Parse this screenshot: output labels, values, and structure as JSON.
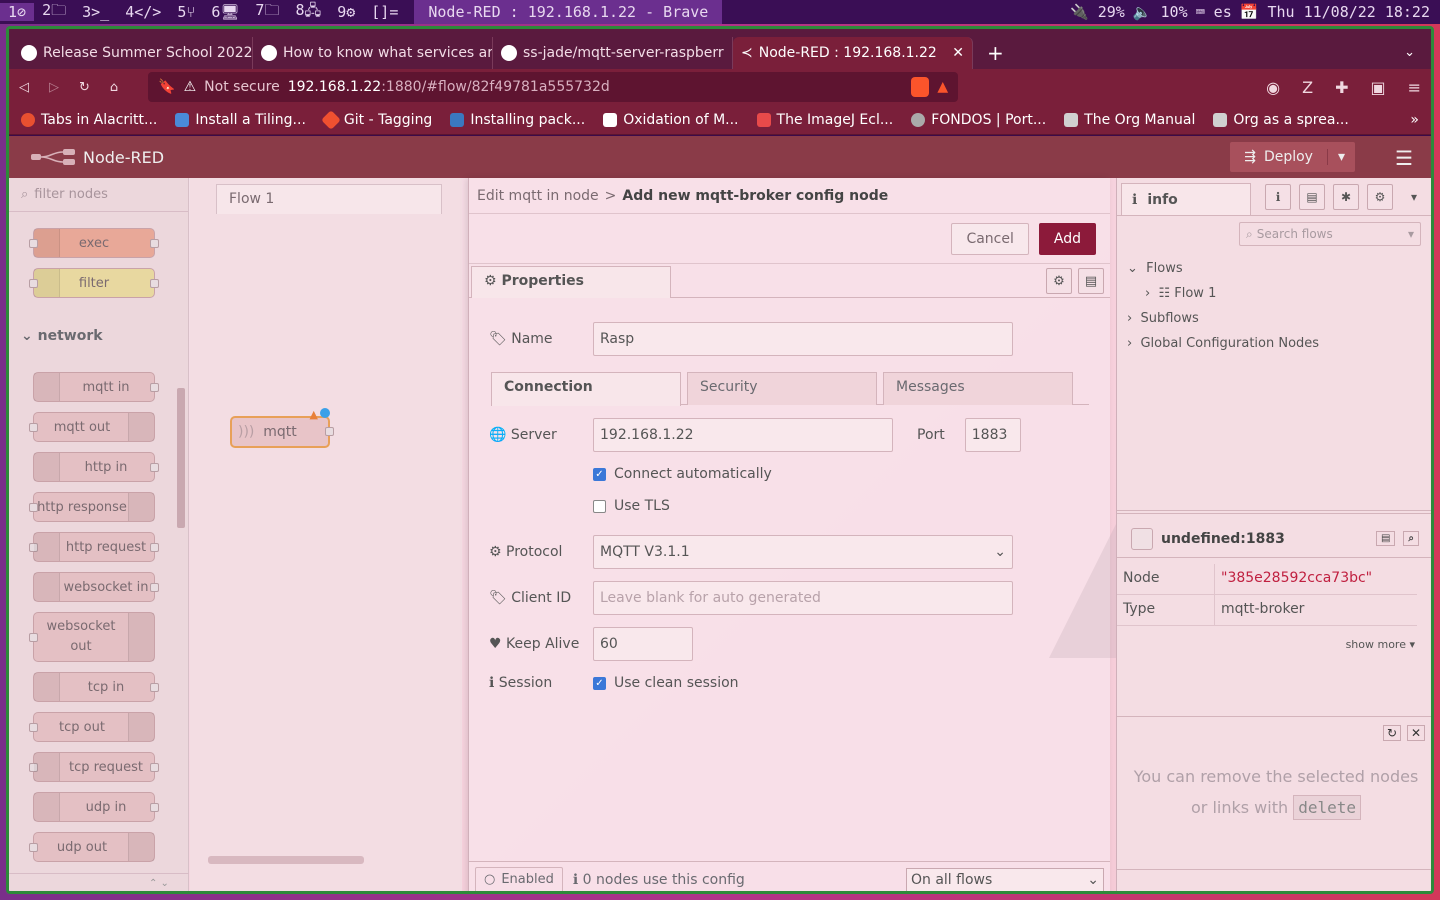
{
  "wm": {
    "workspaces": [
      "1⊘",
      "2🗀",
      "3>_",
      "4</>",
      "5⑂",
      "6🖥",
      "7🗀",
      "8🖧",
      "9⚙"
    ],
    "layout": "[]=",
    "title": "Node-RED : 192.168.1.22 - Brave",
    "status": [
      "🔌 29%",
      "🔈 10%",
      "⌨ es",
      "📅 Thu 11/08/22 18:22"
    ]
  },
  "tabs": [
    {
      "label": "Release Summer School 2022"
    },
    {
      "label": "How to know what services ar"
    },
    {
      "label": "ss-jade/mqtt-server-raspberr"
    },
    {
      "label": "Node-RED : 192.168.1.22"
    }
  ],
  "url": {
    "warning": "Not secure",
    "host": "192.168.1.22",
    "path": ":1880/#flow/82f49781a555732d"
  },
  "bookmarks": [
    "Tabs in Alacritt...",
    "Install a Tiling...",
    "Git - Tagging",
    "Installing pack...",
    "Oxidation of M...",
    "The ImageJ Ecl...",
    "FONDOS | Port...",
    "The Org Manual",
    "Org as a sprea..."
  ],
  "nr": {
    "app_name": "Node-RED",
    "deploy": "Deploy",
    "filter_placeholder": "filter nodes",
    "category": "network",
    "palette_nodes": [
      "exec",
      "filter",
      "mqtt in",
      "mqtt out",
      "http in",
      "http response",
      "http request",
      "websocket in",
      "websocket out",
      "tcp in",
      "tcp out",
      "tcp request",
      "udp in",
      "udp out"
    ],
    "flow_tab": "Flow 1",
    "canvas_node": "mqtt"
  },
  "editor": {
    "breadcrumb": "Edit mqtt in node",
    "separator": ">",
    "title": "Add new mqtt-broker config node",
    "cancel": "Cancel",
    "add": "Add",
    "properties_tab": "Properties",
    "name_label": "Name",
    "name_value": "Rasp",
    "tabs": [
      "Connection",
      "Security",
      "Messages"
    ],
    "server_label": "Server",
    "server_value": "192.168.1.22",
    "port_label": "Port",
    "port_value": "1883",
    "connect_auto": "Connect automatically",
    "use_tls": "Use TLS",
    "protocol_label": "Protocol",
    "protocol_value": "MQTT V3.1.1",
    "client_id_label": "Client ID",
    "client_id_placeholder": "Leave blank for auto generated",
    "keepalive_label": "Keep Alive",
    "keepalive_value": "60",
    "session_label": "Session",
    "clean_session": "Use clean session",
    "enabled": "Enabled",
    "nodes_use": "0 nodes use this config",
    "scope": "On all flows"
  },
  "sidebar": {
    "tab": "info",
    "search_placeholder": "Search flows",
    "tree": {
      "flows": "Flows",
      "flow1": "Flow 1",
      "subflows": "Subflows",
      "global": "Global Configuration Nodes"
    },
    "node_title": "undefined:1883",
    "props": [
      {
        "key": "Node",
        "value": "\"385e28592cca73bc\""
      },
      {
        "key": "Type",
        "value": "mqtt-broker"
      }
    ],
    "show_more": "show more ▾",
    "help_1": "You can remove the selected nodes or links with",
    "help_key": "delete"
  }
}
